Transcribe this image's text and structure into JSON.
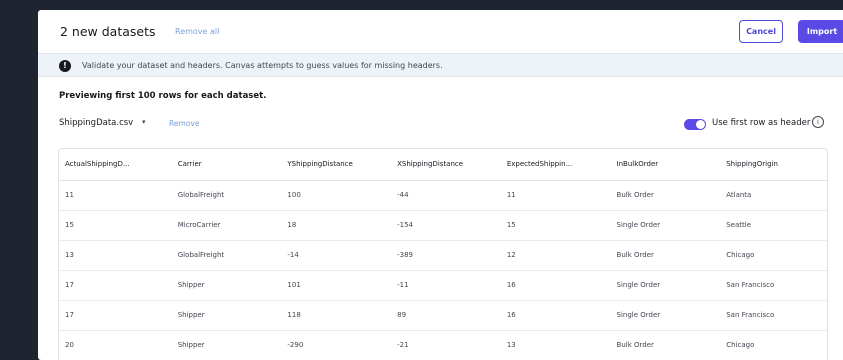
{
  "header": {
    "title": "2 new datasets",
    "remove_all": "Remove all",
    "cancel_label": "Cancel",
    "import_label": "Import"
  },
  "banner": {
    "icon": "info-icon",
    "text": "Validate your dataset and headers. Canvas attempts to guess values for missing headers."
  },
  "preview_note": "Previewing first 100 rows for each dataset.",
  "dataset": {
    "selected": "ShippingData.csv",
    "caret": "▾",
    "remove_label": "Remove"
  },
  "header_toggle": {
    "label": "Use first row as header",
    "on": true
  },
  "table": {
    "columns": [
      "ActualShippingD...",
      "Carrier",
      "YShippingDistance",
      "XShippingDistance",
      "ExpectedShippin...",
      "InBulkOrder",
      "ShippingOrigin"
    ],
    "rows": [
      [
        "11",
        "GlobalFreight",
        "100",
        "-44",
        "11",
        "Bulk Order",
        "Atlanta"
      ],
      [
        "15",
        "MicroCarrier",
        "18",
        "-154",
        "15",
        "Single Order",
        "Seattle"
      ],
      [
        "13",
        "GlobalFreight",
        "-14",
        "-389",
        "12",
        "Bulk Order",
        "Chicago"
      ],
      [
        "17",
        "Shipper",
        "101",
        "-11",
        "16",
        "Single Order",
        "San Francisco"
      ],
      [
        "17",
        "Shipper",
        "118",
        "89",
        "16",
        "Single Order",
        "San Francisco"
      ],
      [
        "20",
        "Shipper",
        "-290",
        "-21",
        "13",
        "Bulk Order",
        "Chicago"
      ]
    ]
  },
  "colors": {
    "accent": "#5b49e6",
    "link": "#7a9fd8",
    "banner_bg": "#eef3f9",
    "backdrop": "#1e2530"
  }
}
